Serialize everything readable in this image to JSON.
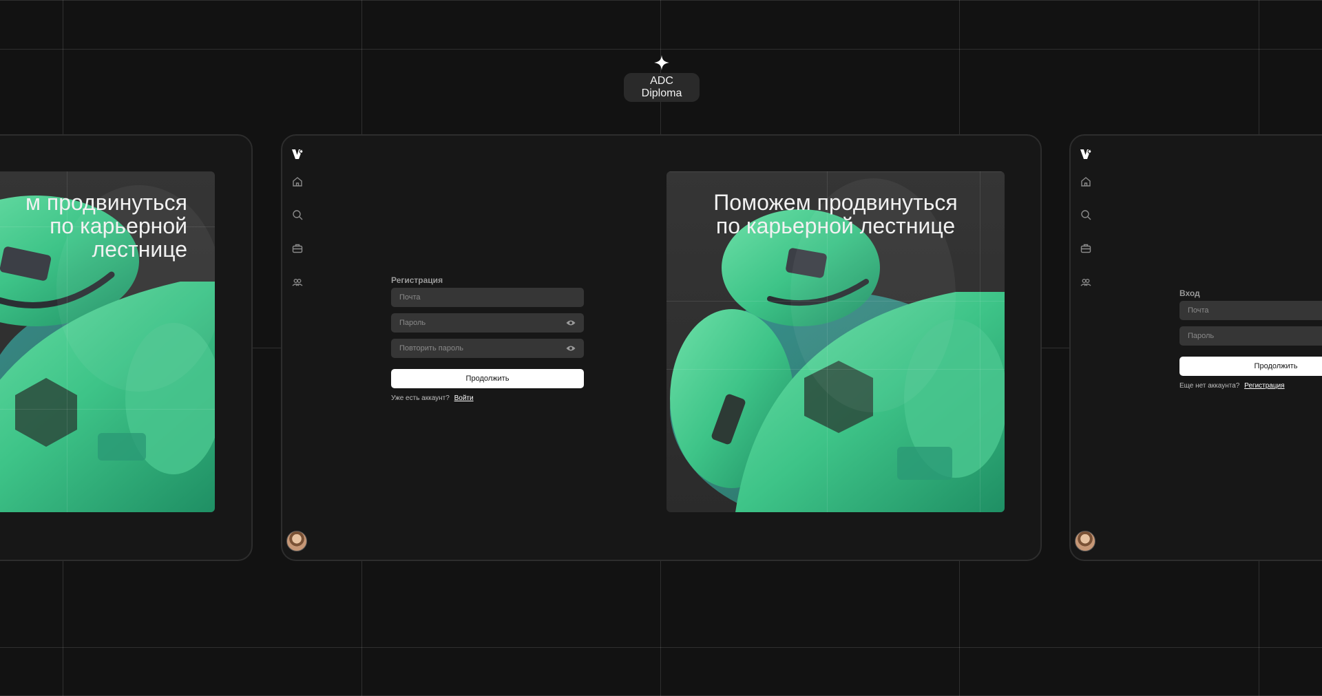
{
  "badge": {
    "label": "ADC Diploma"
  },
  "promo": {
    "line1": "Поможем продвинуться",
    "line2": "по карьерной лестнице"
  },
  "promo_left": {
    "line1": "м продвинуться",
    "line2": "по карьерной лестнице"
  },
  "register": {
    "title": "Регистрация",
    "email_placeholder": "Почта",
    "password_placeholder": "Пароль",
    "repeat_password_placeholder": "Повторить пароль",
    "continue_label": "Продолжить",
    "have_account_text": "Уже есть аккаунт?",
    "login_link": "Войти"
  },
  "login": {
    "title": "Вход",
    "email_placeholder": "Почта",
    "password_placeholder": "Пароль",
    "continue_label": "Продолжить",
    "no_account_text": "Еще нет аккаунта?",
    "register_link": "Регистрация"
  },
  "sidebar": {
    "icons": [
      "logo-icon",
      "home-icon",
      "search-icon",
      "briefcase-icon",
      "people-icon",
      "avatar"
    ]
  },
  "colors": {
    "background": "#121212",
    "panel": "#171717",
    "accent_green": "#3ec488",
    "field": "#363636"
  }
}
